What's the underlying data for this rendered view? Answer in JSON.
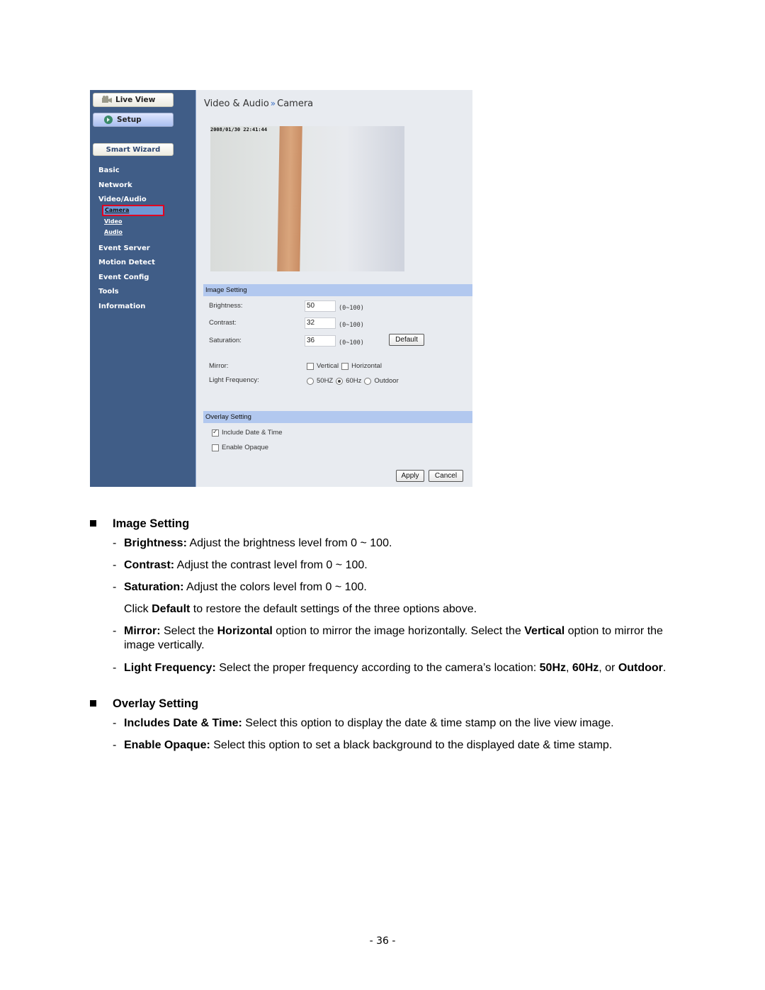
{
  "screenshot": {
    "sidebar": {
      "live_view": "Live View",
      "setup": "Setup",
      "smart_wizard": "Smart Wizard",
      "items": [
        "Basic",
        "Network",
        "Video/Audio",
        "Event Server",
        "Motion Detect",
        "Event Config",
        "Tools",
        "Information"
      ],
      "sub_items": [
        "Camera",
        "Video",
        "Audio"
      ],
      "active_sub_item": "Camera"
    },
    "breadcrumb": {
      "section": "Video & Audio",
      "separator": "»",
      "page": "Camera"
    },
    "camera_timestamp": "2008/01/30 22:41:44",
    "image_setting": {
      "header": "Image Setting",
      "brightness_label": "Brightness:",
      "brightness_value": "50",
      "contrast_label": "Contrast:",
      "contrast_value": "32",
      "saturation_label": "Saturation:",
      "saturation_value": "36",
      "range": "(0~100)",
      "default_button": "Default",
      "mirror_label": "Mirror:",
      "mirror_vertical": "Vertical",
      "mirror_horizontal": "Horizontal",
      "light_label": "Light Frequency:",
      "light_options": [
        "50HZ",
        "60Hz",
        "Outdoor"
      ],
      "light_selected": "60Hz"
    },
    "overlay_setting": {
      "header": "Overlay Setting",
      "include_date_time": "Include Date & Time",
      "include_date_time_checked": true,
      "enable_opaque": "Enable Opaque",
      "enable_opaque_checked": false,
      "apply_button": "Apply",
      "cancel_button": "Cancel"
    }
  },
  "document": {
    "image_setting_heading": "Image Setting",
    "brightness": {
      "term": "Brightness:",
      "text": " Adjust the brightness level from 0 ~ 100."
    },
    "contrast": {
      "term": "Contrast:",
      "text": " Adjust the contrast level from 0 ~ 100."
    },
    "saturation": {
      "term": "Saturation:",
      "text": " Adjust the colors level from 0 ~ 100."
    },
    "default_note": {
      "pre": "Click ",
      "bold": "Default",
      "post": " to restore the default settings of the three options above."
    },
    "mirror": {
      "term": "Mirror:",
      "t1": " Select the ",
      "b1": "Horizontal",
      "t2": " option to mirror the image horizontally. Select the ",
      "b2": "Vertical",
      "t3": " option to mirror the image vertically."
    },
    "light": {
      "term": "Light Frequency:",
      "t1": " Select the proper frequency according to the camera’s location: ",
      "b1": "50Hz",
      "t2": ", ",
      "b2": "60Hz",
      "t3": ", or ",
      "b3": "Outdoor",
      "t4": "."
    },
    "overlay_heading": "Overlay Setting",
    "include_date": {
      "term": "Includes Date & Time:",
      "text": " Select this option to display the date & time stamp on the live view image."
    },
    "opaque": {
      "term": "Enable Opaque:",
      "text": " Select this option to set a black background to the displayed date & time stamp."
    },
    "dash": "-",
    "page_number": "- 36 -"
  }
}
